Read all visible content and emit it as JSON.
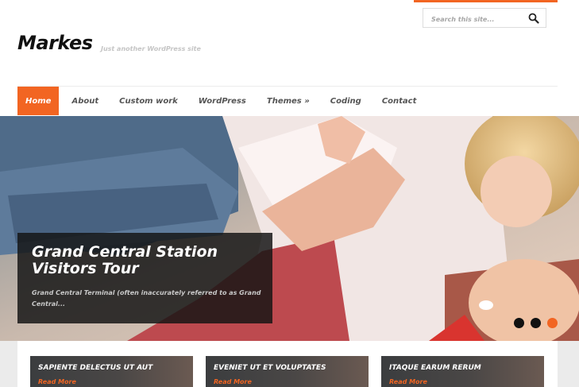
{
  "search": {
    "placeholder": "Search this site..."
  },
  "site": {
    "title": "Markes",
    "tagline": "Just another WordPress site"
  },
  "nav": {
    "items": [
      {
        "label": "Home",
        "active": true
      },
      {
        "label": "About"
      },
      {
        "label": "Custom work"
      },
      {
        "label": "WordPress"
      },
      {
        "label": "Themes »"
      },
      {
        "label": "Coding"
      },
      {
        "label": "Contact"
      }
    ]
  },
  "slider": {
    "title": "Grand Central Station Visitors Tour",
    "excerpt": "Grand Central Terminal (often inaccurately referred to as Grand Central...",
    "slide_count": 3,
    "active_slide": 3
  },
  "posts": [
    {
      "title": "SAPIENTE DELECTUS UT AUT",
      "link": "Read More"
    },
    {
      "title": "EVENIET UT ET VOLUPTATES",
      "link": "Read More"
    },
    {
      "title": "ITAQUE EARUM RERUM",
      "link": "Read More"
    }
  ],
  "colors": {
    "accent": "#f26522",
    "dark_overlay": "#141414",
    "nav_text": "#555555"
  },
  "icons": {
    "search": "search-icon"
  }
}
